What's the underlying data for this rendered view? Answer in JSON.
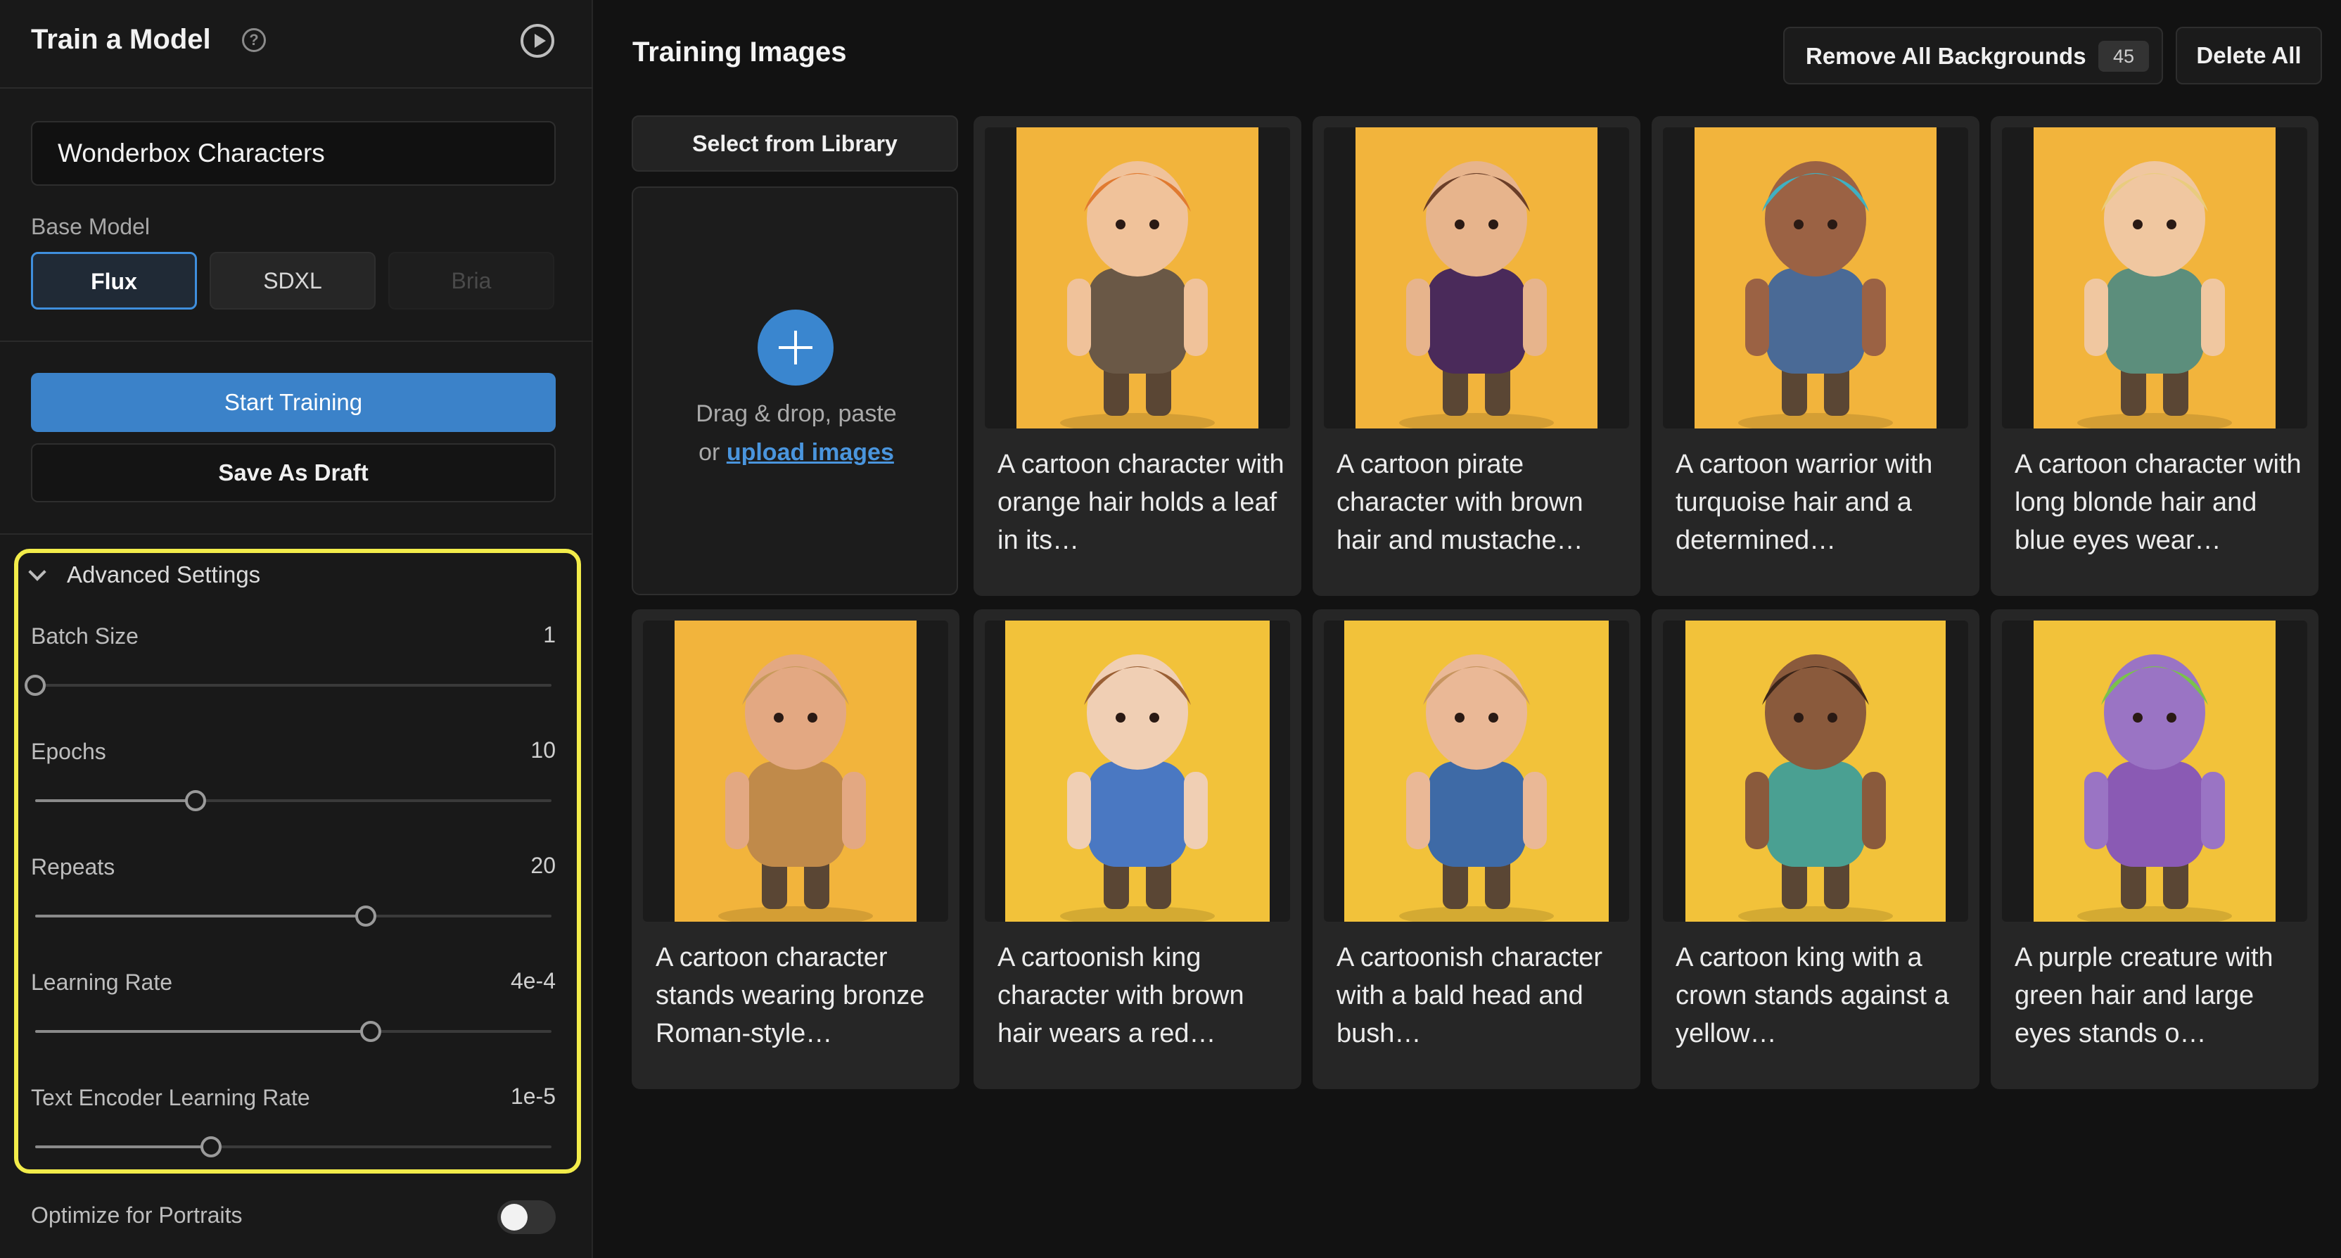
{
  "sidebar": {
    "title": "Train a Model",
    "model_name": "Wonderbox Characters",
    "base_model_label": "Base Model",
    "base_models": [
      "Flux",
      "SDXL",
      "Bria"
    ],
    "selected_model": "Flux",
    "start_training_label": "Start Training",
    "save_draft_label": "Save As Draft",
    "advanced": {
      "title": "Advanced Settings",
      "expanded": true,
      "batch_size": {
        "label": "Batch Size",
        "value": "1",
        "fraction": 0.0
      },
      "epochs": {
        "label": "Epochs",
        "value": "10",
        "fraction": 0.31
      },
      "repeats": {
        "label": "Repeats",
        "value": "20",
        "fraction": 0.64
      },
      "learning_rate": {
        "label": "Learning Rate",
        "value": "4e-4",
        "fraction": 0.65
      },
      "text_encoder_lr": {
        "label": "Text Encoder Learning Rate",
        "value": "1e-5",
        "fraction": 0.34
      }
    },
    "optimize_portraits": {
      "label": "Optimize for Portraits",
      "enabled": false
    }
  },
  "main": {
    "title": "Training Images",
    "remove_bg_label": "Remove All Backgrounds",
    "image_count": "45",
    "delete_all_label": "Delete All",
    "select_library_label": "Select from Library",
    "dropzone": {
      "line1": "Drag & drop, paste",
      "line2_prefix": "or ",
      "link": "upload images"
    },
    "images": [
      {
        "caption": "A cartoon character with orange hair holds a leaf in its…",
        "bg": "#f2b43c",
        "hair": "#e07a30",
        "body": "#6a5846",
        "skin": "#f0c29a"
      },
      {
        "caption": "A cartoon pirate character with brown hair and mustache…",
        "bg": "#f2b43c",
        "hair": "#6a3e28",
        "body": "#4a2a5a",
        "skin": "#e7b48c"
      },
      {
        "caption": "A cartoon warrior with turquoise hair and a determined…",
        "bg": "#f2b43c",
        "hair": "#3fb1c2",
        "body": "#4a6a96",
        "skin": "#9b6244"
      },
      {
        "caption": "A cartoon character with long blonde hair and blue eyes wear…",
        "bg": "#f2b43c",
        "hair": "#e9cc7e",
        "body": "#5c8e7c",
        "skin": "#f0c7a0"
      },
      {
        "caption": "A cartoon character stands wearing bronze Roman-style…",
        "bg": "#f2b43c",
        "hair": "#c89a5a",
        "body": "#c08a4a",
        "skin": "#e3a882"
      },
      {
        "caption": "A cartoonish king character with brown hair wears a red…",
        "bg": "#f2c23a",
        "hair": "#9a6034",
        "body": "#4a78c2",
        "skin": "#f0cfb4"
      },
      {
        "caption": "A cartoonish character with a bald head and bush…",
        "bg": "#f2c23a",
        "hair": "#c7955f",
        "body": "#3e6aa6",
        "skin": "#eab896"
      },
      {
        "caption": "A cartoon king with a crown stands against a yellow…",
        "bg": "#f2c23a",
        "hair": "#3a2418",
        "body": "#4aa092",
        "skin": "#8a5a3c"
      },
      {
        "caption": "A purple creature with green hair and large eyes stands o…",
        "bg": "#f2c23a",
        "hair": "#7ac24a",
        "body": "#8a5ab4",
        "skin": "#9a74c4"
      }
    ]
  }
}
